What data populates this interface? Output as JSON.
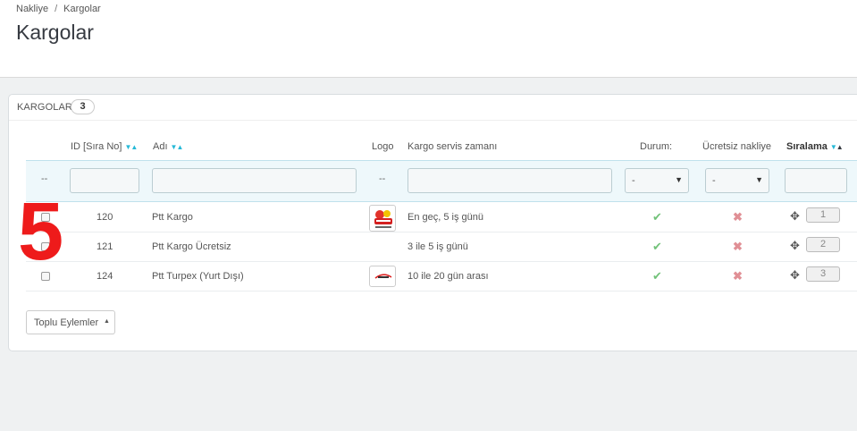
{
  "breadcrumb": {
    "parent": "Nakliye",
    "separator": "/",
    "current": "Kargolar"
  },
  "page_title": "Kargolar",
  "panel": {
    "title": "KARGOLAR",
    "count": "3"
  },
  "columns": {
    "id": "ID [Sıra No]",
    "name": "Adı",
    "logo": "Logo",
    "delay": "Kargo servis zamanı",
    "status": "Durum:",
    "free": "Ücretsiz nakliye",
    "position": "Sıralama"
  },
  "filters": {
    "check_dash": "--",
    "logo_dash": "--",
    "status_value": "-",
    "free_value": "-"
  },
  "rows": [
    {
      "id": "120",
      "name": "Ptt Kargo",
      "delay": "En geç, 5 iş günü",
      "has_logo": true,
      "active": true,
      "free": false,
      "position": "1"
    },
    {
      "id": "121",
      "name": "Ptt Kargo Ücretsiz",
      "delay": "3 ile 5 iş günü",
      "has_logo": false,
      "active": true,
      "free": false,
      "position": "2"
    },
    {
      "id": "124",
      "name": "Ptt Turpex (Yurt Dışı)",
      "delay": "10 ile 20 gün arası",
      "has_logo": true,
      "active": true,
      "free": false,
      "position": "3"
    }
  ],
  "bulk_actions_label": "Toplu Eylemler",
  "overlay_number": "5",
  "icons": {
    "active": "check-icon",
    "inactive": "cross-icon",
    "drag": "move-icon"
  },
  "colors": {
    "accent": "#25b9d7",
    "check": "#72c279",
    "cross": "#e08f95",
    "overlay": "#ee1b1b"
  }
}
